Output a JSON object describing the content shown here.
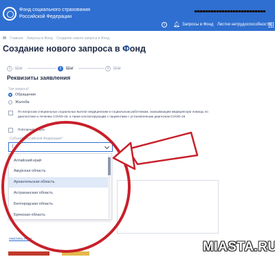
{
  "header": {
    "org_line1": "Фонд социального страхования",
    "org_line2": "Российской Федерации",
    "bell_icon": "bell-icon",
    "link_requests": "Запросы в Фонд",
    "link_sick_leave": "Листки нетрудоспособности",
    "accent": "#2f6fd1"
  },
  "breadcrumbs": [
    "Главная",
    "Запросы в Фонд",
    "Создание нового запроса в Фонд"
  ],
  "page_title": "Создание нового запроса в Фонд",
  "steps": [
    {
      "number": "1",
      "label": "Шаг"
    },
    {
      "number": "2",
      "label": "Шаг"
    },
    {
      "number": "3",
      "label": "Шаг"
    }
  ],
  "section_title": "Реквизиты заявления",
  "request_type": {
    "label": "Тип запроса*",
    "options": [
      "Обращение",
      "Жалоба"
    ],
    "selected": "Обращение"
  },
  "covid_checkbox_text_1": "По вопросам специальных социальных выплат медицинским и социальным работникам, оказывающим медицинскую помощь по",
  "covid_checkbox_text_2": "диагностике и лечению COVID-19, а также контактирующим с пациентами с установленным диагнозом COVID-19",
  "repeat_checkbox_text": "Повторный запрос",
  "region": {
    "label": "Субъект Российской Федерации*",
    "value": "|",
    "options": [
      "Алтайский край",
      "Амурская область",
      "Архангельская область",
      "Астраханская область",
      "Белгородская область",
      "Брянская область"
    ],
    "highlighted": "Архангельская область"
  },
  "clear_link": "очистить поля",
  "watermark": "MIASTA.RU",
  "annotation_color": "#c8202a"
}
